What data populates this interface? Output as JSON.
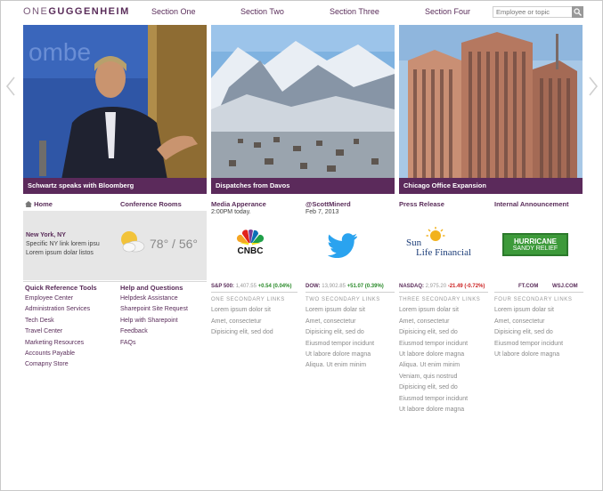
{
  "header": {
    "logo_one": "ONE",
    "logo_rest": "GUGGENHEIM",
    "nav": [
      "Section One",
      "Section Two",
      "Section Three",
      "Section Four"
    ],
    "search_placeholder": "Employee or topic"
  },
  "hero": [
    {
      "caption": "Schwartz speaks with Bloomberg"
    },
    {
      "caption": "Dispatches from Davos"
    },
    {
      "caption": "Chicago Office Expansion"
    }
  ],
  "col1": {
    "home": "Home",
    "city": "New York, NY",
    "desc1": "Specific NY link lorem ipsu",
    "desc2": "Lorem ipsum dolar listos",
    "temp": "78° / 56°",
    "quick_title": "Quick Reference Tools",
    "quick": [
      "Employee Center",
      "Administration Services",
      "Tech Desk",
      "Travel Center",
      "Marketing Resources",
      "Accounts Payable",
      "Comapny Store"
    ]
  },
  "col2": {
    "title": "Conference Rooms",
    "help_title": "Help and Questions",
    "help": [
      "Helpdesk Assistance",
      "Sharepoint Site Request",
      "Help with Sharepoint",
      "Feedback",
      "FAQs"
    ]
  },
  "col3": {
    "title": "Media Apperance",
    "time": "2:00PM today.",
    "ticker_label": "S&P 500:",
    "ticker_value": "1,407.55",
    "ticker_change": "+0.54 (0.04%)",
    "links_title": "ONE SECONDARY LINKS",
    "links": [
      "Lorem ipsum dolor sit",
      "Amet, consectetur",
      "Dipisicing elit, sed dod"
    ]
  },
  "col4": {
    "title": "@ScottMinerd",
    "date": "Feb 7, 2013",
    "ticker_label": "DOW:",
    "ticker_value": "13,902.85",
    "ticker_change": "+51.07 (0.39%)",
    "links_title": "TWO SECONDARY LINKS",
    "links": [
      "Lorem ipsum dolar sit",
      "Amet, consectetur",
      "Dipisicing elit, sed do",
      "Eiusmod tempor incidunt",
      "Ut labore dolore magna",
      "Aliqua. Ut enim minim"
    ]
  },
  "col5": {
    "title": "Press Release",
    "logo_line1": "Sun",
    "logo_line2": "Life Financial",
    "ticker_label": "NASDAQ:",
    "ticker_value": "2,975.20",
    "ticker_change": "-21.49 (-0.72%)",
    "links_title": "THREE SECONDARY LINKS",
    "links": [
      "Lorem ipsum dolar sit",
      "Amet, consectetur",
      "Dipisicing elit, sed do",
      "Eiusmod tempor incidunt",
      "Ut labore dolore magna",
      "Aliqua. Ut enim minim",
      "Veniam, quis nostrud",
      "Dipisicing elit, sed do",
      "Eiusmod tempor incidunt",
      "Ut labore dolore magna"
    ]
  },
  "col6": {
    "title": "Internal Announcement",
    "banner1": "HURRICANE",
    "banner2": "SANDY RELIEF",
    "link_ft": "FT.COM",
    "link_wsj": "WSJ.COM",
    "links_title": "FOUR SECONDARY LINKS",
    "links": [
      "Lorem ipsum dolar sit",
      "Amet, consectetur",
      "Dipisicing elit, sed do",
      "Eiusmod tempor incidunt",
      "Ut labore dolore magna"
    ]
  },
  "media": {
    "cnbc": "CNBC"
  },
  "colors": {
    "brand": "#5b2a5b",
    "up": "#2a8a2a",
    "down": "#cc2222"
  },
  "icons": [
    "chevron-left-icon",
    "chevron-right-icon",
    "search-icon",
    "home-icon",
    "weather-icon",
    "twitter-icon",
    "cnbc-icon",
    "sun-icon"
  ]
}
